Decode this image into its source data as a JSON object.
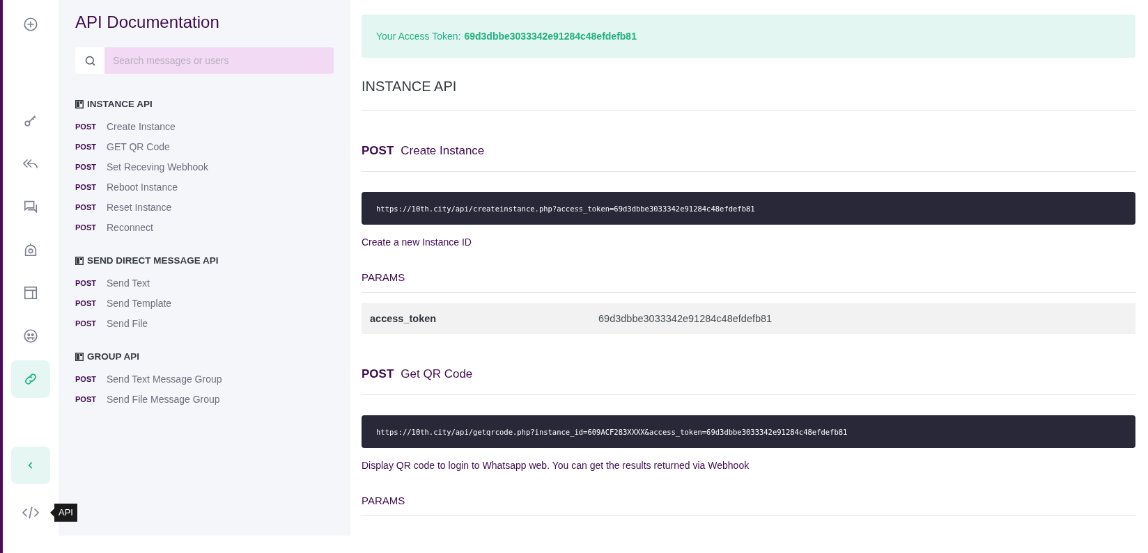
{
  "rail": {
    "items": [
      {
        "kind": "add",
        "selected": false
      },
      {
        "kind": "key",
        "selected": false
      },
      {
        "kind": "reply",
        "selected": false
      },
      {
        "kind": "chat",
        "selected": false
      },
      {
        "kind": "camera",
        "selected": false
      },
      {
        "kind": "layout",
        "selected": false
      },
      {
        "kind": "emoji",
        "selected": false
      },
      {
        "kind": "link",
        "selected": true
      }
    ],
    "collapse": {
      "kind": "chevron"
    },
    "api": {
      "kind": "code",
      "tooltip": "API"
    }
  },
  "sidebar": {
    "title": "API Documentation",
    "search": {
      "placeholder": "Search messages or users"
    },
    "groups": [
      {
        "title": "INSTANCE API",
        "items": [
          {
            "method": "POST",
            "label": "Create Instance"
          },
          {
            "method": "POST",
            "label": "GET QR Code"
          },
          {
            "method": "POST",
            "label": "Set Receving Webhook"
          },
          {
            "method": "POST",
            "label": "Reboot Instance"
          },
          {
            "method": "POST",
            "label": "Reset Instance"
          },
          {
            "method": "POST",
            "label": "Reconnect"
          }
        ]
      },
      {
        "title": "SEND DIRECT MESSAGE API",
        "items": [
          {
            "method": "POST",
            "label": "Send Text"
          },
          {
            "method": "POST",
            "label": "Send Template"
          },
          {
            "method": "POST",
            "label": "Send File"
          }
        ]
      },
      {
        "title": "GROUP API",
        "items": [
          {
            "method": "POST",
            "label": "Send Text Message Group"
          },
          {
            "method": "POST",
            "label": "Send File Message Group"
          }
        ]
      }
    ]
  },
  "main": {
    "token": {
      "label": "Your Access Token:",
      "value": "69d3dbbe3033342e91284c48efdefb81"
    },
    "section_title": "INSTANCE API",
    "endpoints": [
      {
        "method": "POST",
        "title": "Create Instance",
        "url": "https://10th.city/api/createinstance.php?access_token=69d3dbbe3033342e91284c48efdefb81",
        "description": "Create a new Instance ID",
        "params_title": "PARAMS",
        "params": [
          {
            "name": "access_token",
            "value": "69d3dbbe3033342e91284c48efdefb81"
          }
        ]
      },
      {
        "method": "POST",
        "title": "Get QR Code",
        "url": "https://10th.city/api/getqrcode.php?instance_id=609ACF283XXXX&access_token=69d3dbbe3033342e91284c48efdefb81",
        "description": "Display QR code to login to Whatsapp web. You can get the results returned via Webhook",
        "params_title": "PARAMS"
      }
    ]
  }
}
